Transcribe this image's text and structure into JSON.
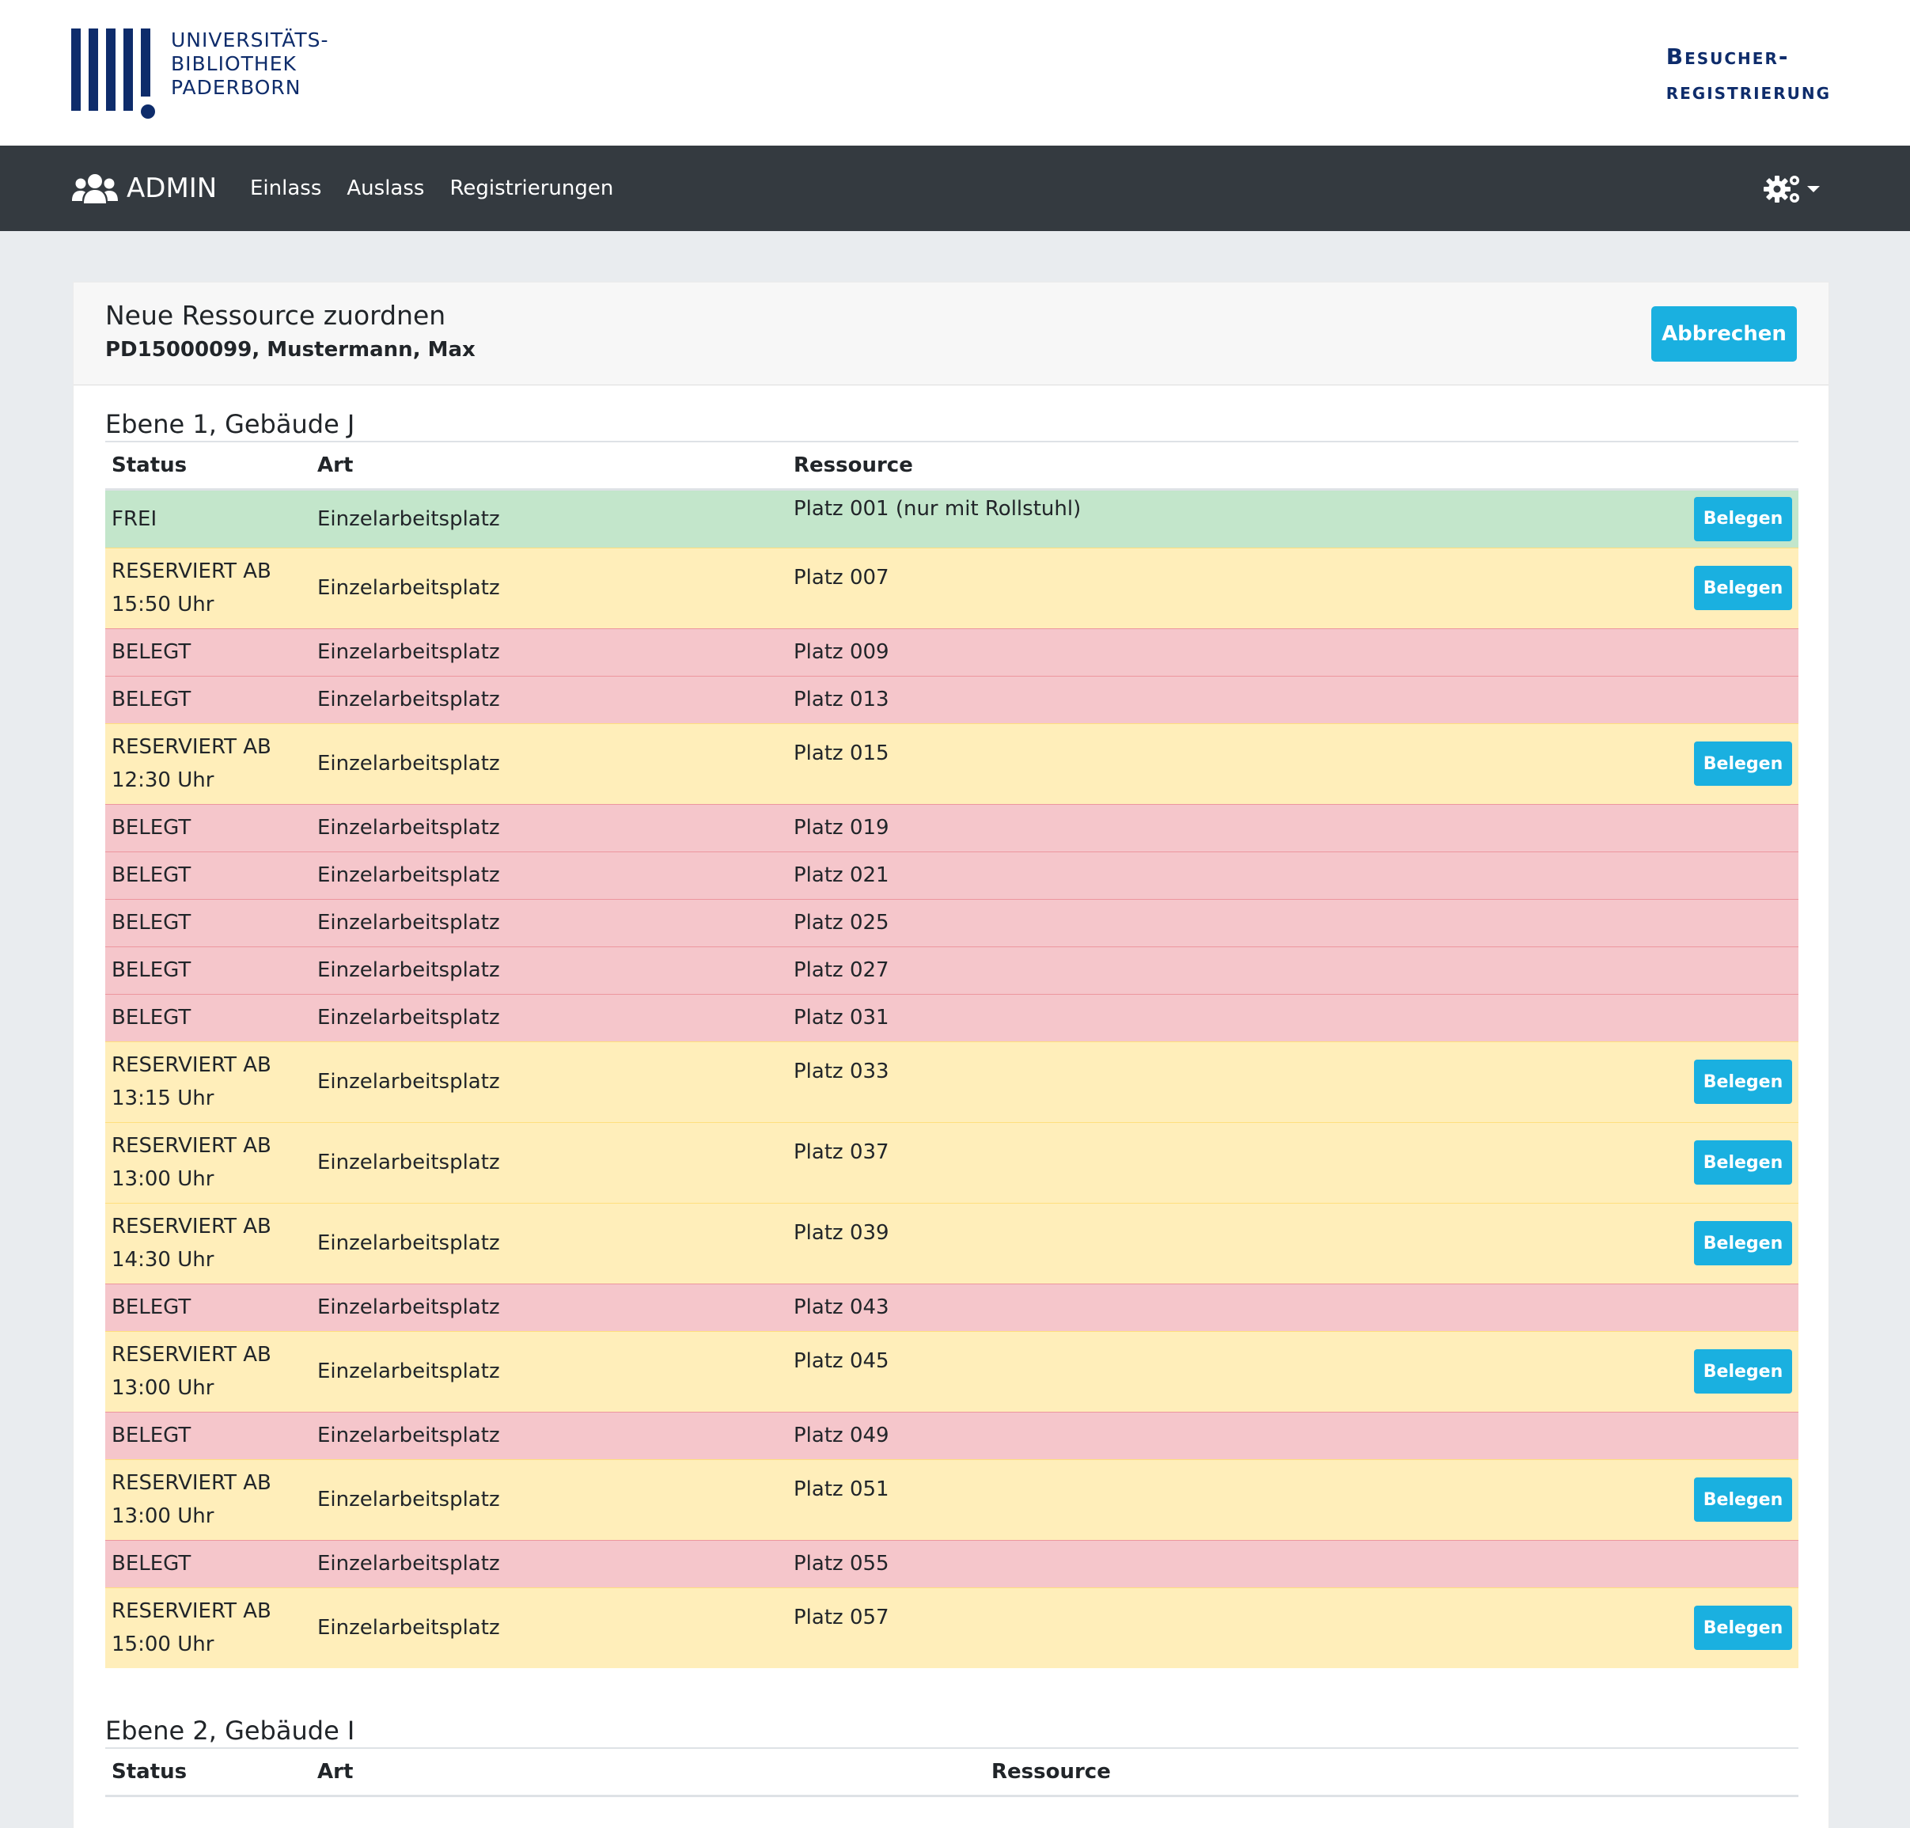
{
  "header": {
    "logo_lines": [
      "UNIVERSITÄTS-",
      "BIBLIOTHEK",
      "PADERBORN"
    ],
    "app_title_lines": [
      "Besucher-",
      "registrierung"
    ]
  },
  "navbar": {
    "brand_icon": "users-icon",
    "brand_label": "ADMIN",
    "links": [
      "Einlass",
      "Auslass",
      "Registrierungen"
    ],
    "settings_icon": "gears-icon"
  },
  "card": {
    "title": "Neue Ressource zuordnen",
    "subtitle": "PD15000099, Mustermann, Max",
    "cancel_label": "Abbrechen"
  },
  "table_headers": {
    "status": "Status",
    "art": "Art",
    "ressource": "Ressource"
  },
  "book_label": "Belegen",
  "colors": {
    "frei": "#c3e6cb",
    "reserviert": "#ffeeba",
    "belegt": "#f5c6cb",
    "button": "#1ab0e0",
    "navbar": "#343a40",
    "brand": "#0e2c6b"
  },
  "sections": [
    {
      "title": "Ebene 1, Gebäude J",
      "rows": [
        {
          "status": "FREI",
          "art": "Einzelarbeitsplatz",
          "ressource": "Platz 001 (nur mit Rollstuhl)",
          "state": "frei",
          "bookable": true
        },
        {
          "status": "RESERVIERT AB 15:50 Uhr",
          "art": "Einzelarbeitsplatz",
          "ressource": "Platz 007",
          "state": "res",
          "bookable": true
        },
        {
          "status": "BELEGT",
          "art": "Einzelarbeitsplatz",
          "ressource": "Platz 009",
          "state": "bel",
          "bookable": false
        },
        {
          "status": "BELEGT",
          "art": "Einzelarbeitsplatz",
          "ressource": "Platz 013",
          "state": "bel",
          "bookable": false
        },
        {
          "status": "RESERVIERT AB 12:30 Uhr",
          "art": "Einzelarbeitsplatz",
          "ressource": "Platz 015",
          "state": "res",
          "bookable": true
        },
        {
          "status": "BELEGT",
          "art": "Einzelarbeitsplatz",
          "ressource": "Platz 019",
          "state": "bel",
          "bookable": false
        },
        {
          "status": "BELEGT",
          "art": "Einzelarbeitsplatz",
          "ressource": "Platz 021",
          "state": "bel",
          "bookable": false
        },
        {
          "status": "BELEGT",
          "art": "Einzelarbeitsplatz",
          "ressource": "Platz 025",
          "state": "bel",
          "bookable": false
        },
        {
          "status": "BELEGT",
          "art": "Einzelarbeitsplatz",
          "ressource": "Platz 027",
          "state": "bel",
          "bookable": false
        },
        {
          "status": "BELEGT",
          "art": "Einzelarbeitsplatz",
          "ressource": "Platz 031",
          "state": "bel",
          "bookable": false
        },
        {
          "status": "RESERVIERT AB 13:15 Uhr",
          "art": "Einzelarbeitsplatz",
          "ressource": "Platz 033",
          "state": "res",
          "bookable": true
        },
        {
          "status": "RESERVIERT AB 13:00 Uhr",
          "art": "Einzelarbeitsplatz",
          "ressource": "Platz 037",
          "state": "res",
          "bookable": true
        },
        {
          "status": "RESERVIERT AB 14:30 Uhr",
          "art": "Einzelarbeitsplatz",
          "ressource": "Platz 039",
          "state": "res",
          "bookable": true
        },
        {
          "status": "BELEGT",
          "art": "Einzelarbeitsplatz",
          "ressource": "Platz 043",
          "state": "bel",
          "bookable": false
        },
        {
          "status": "RESERVIERT AB 13:00 Uhr",
          "art": "Einzelarbeitsplatz",
          "ressource": "Platz 045",
          "state": "res",
          "bookable": true
        },
        {
          "status": "BELEGT",
          "art": "Einzelarbeitsplatz",
          "ressource": "Platz 049",
          "state": "bel",
          "bookable": false
        },
        {
          "status": "RESERVIERT AB 13:00 Uhr",
          "art": "Einzelarbeitsplatz",
          "ressource": "Platz 051",
          "state": "res",
          "bookable": true
        },
        {
          "status": "BELEGT",
          "art": "Einzelarbeitsplatz",
          "ressource": "Platz 055",
          "state": "bel",
          "bookable": false
        },
        {
          "status": "RESERVIERT AB 15:00 Uhr",
          "art": "Einzelarbeitsplatz",
          "ressource": "Platz 057",
          "state": "res",
          "bookable": true
        }
      ]
    },
    {
      "title": "Ebene 2, Gebäude I",
      "rows": []
    }
  ]
}
